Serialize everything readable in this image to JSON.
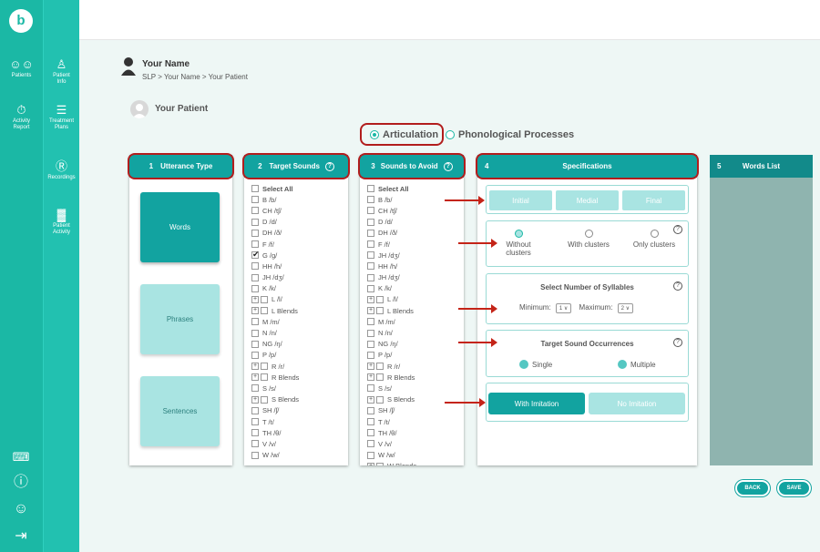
{
  "nav": {
    "primary": [
      {
        "label": "Patients",
        "icon": "patients-icon"
      },
      {
        "label": "Activity Report",
        "icon": "activity-report-icon"
      }
    ],
    "secondary": [
      {
        "label": "Patient Info",
        "icon": "patient-info-icon"
      },
      {
        "label": "Treatment Plans",
        "icon": "treatment-plans-icon"
      },
      {
        "label": "Recordings",
        "icon": "recordings-icon"
      },
      {
        "label": "Patient Activity",
        "icon": "patient-activity-icon"
      }
    ],
    "logo_letter": "b"
  },
  "header": {
    "name": "Your Name",
    "breadcrumb": "SLP  >  Your Name  >  Your Patient",
    "patient": "Your Patient"
  },
  "mode": {
    "articulation": "Articulation",
    "phonological": "Phonological Processes",
    "selected": "articulation"
  },
  "utterance": {
    "number": "1",
    "title": "Utterance Type",
    "options": [
      "Words",
      "Phrases",
      "Sentences"
    ],
    "selected": "Words"
  },
  "target": {
    "number": "2",
    "title": "Target Sounds",
    "items": [
      "Select All",
      "B /b/",
      "CH /tʃ/",
      "D /d/",
      "DH /ð/",
      "F /f/",
      "G /g/",
      "HH /h/",
      "JH /dʒ/",
      "K /k/",
      "L /l/",
      "L Blends",
      "M /m/",
      "N /n/",
      "NG /ŋ/",
      "P /p/",
      "R /r/",
      "R Blends",
      "S /s/",
      "S Blends",
      "SH /ʃ/",
      "T /t/",
      "TH /θ/",
      "V /v/",
      "W /w/"
    ],
    "checked": [
      "G /g/"
    ],
    "expandable": [
      "L /l/",
      "L Blends",
      "R /r/",
      "R Blends",
      "S Blends"
    ]
  },
  "avoid": {
    "number": "3",
    "title": "Sounds to Avoid",
    "items": [
      "Select All",
      "B /b/",
      "CH /tʃ/",
      "D /d/",
      "DH /ð/",
      "F /f/",
      "JH /dʒ/",
      "HH /h/",
      "JH /dʒ/",
      "K /k/",
      "L /l/",
      "L Blends",
      "M /m/",
      "N /n/",
      "NG /ŋ/",
      "P /p/",
      "R /r/",
      "R Blends",
      "S /s/",
      "S Blends",
      "SH /ʃ/",
      "T /t/",
      "TH /θ/",
      "V /v/",
      "W /w/",
      "W Blends"
    ],
    "expandable": [
      "L /l/",
      "L Blends",
      "R /r/",
      "R Blends",
      "S Blends",
      "W Blends"
    ]
  },
  "specs": {
    "number": "4",
    "title": "Specifications",
    "positions": [
      "Initial",
      "Medial",
      "Final"
    ],
    "clusters": [
      "Without clusters",
      "With clusters",
      "Only clusters"
    ],
    "clusters_selected": "Without clusters",
    "syllables_title": "Select Number of Syllables",
    "min_label": "Minimum:",
    "min_value": "1",
    "max_label": "Maximum:",
    "max_value": "2",
    "occurrences_title": "Target Sound Occurrences",
    "occurrences": [
      "Single",
      "Multiple"
    ],
    "imitation": [
      "With Imitation",
      "No Imitation"
    ],
    "imitation_selected": "With Imitation"
  },
  "words": {
    "number": "5",
    "title": "Words List"
  },
  "actions": {
    "back": "BACK",
    "save": "SAVE"
  },
  "colors": {
    "accent": "#12a3a0",
    "rail": "#1bb8a5",
    "highlight": "#b21d1d"
  }
}
